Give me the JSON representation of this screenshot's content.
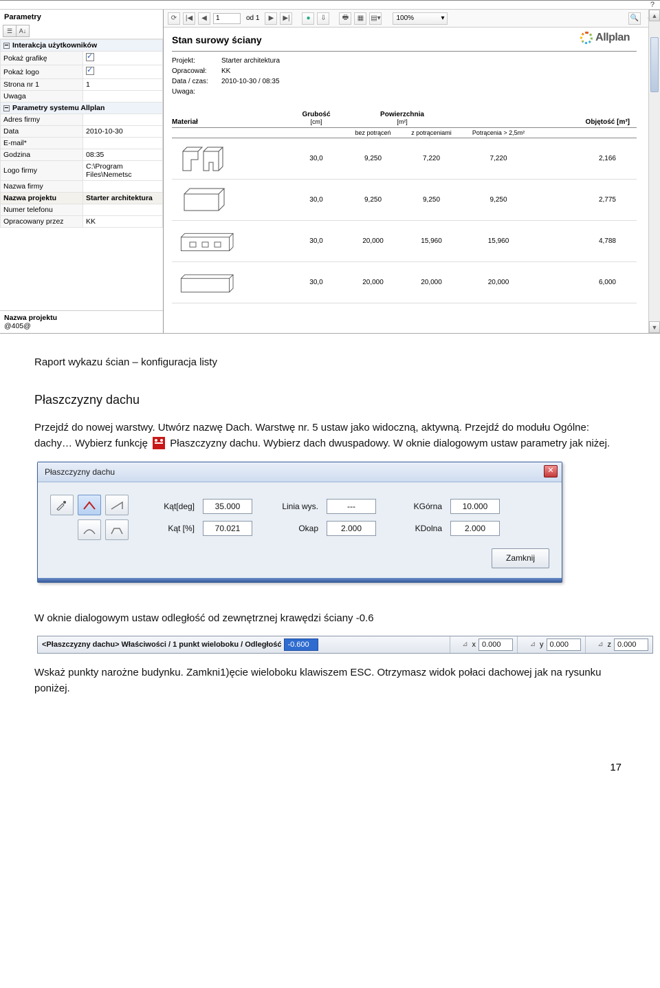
{
  "viewer": {
    "help": "?",
    "prop_title": "Parametry",
    "sections": {
      "s1": "Interakcja użytkowników",
      "s2": "Parametry systemu Allplan"
    },
    "rows": {
      "pokaz_grafike": "Pokaż grafikę",
      "pokaz_logo": "Pokaż logo",
      "strona_nr": "Strona nr 1",
      "strona_nr_val": "1",
      "uwaga": "Uwaga",
      "adres": "Adres firmy",
      "data": "Data",
      "data_val": "2010-10-30",
      "email": "E-mail*",
      "godzina": "Godzina",
      "godzina_val": "08:35",
      "logo_firmy": "Logo firmy",
      "logo_val": "C:\\Program Files\\Nemetsc",
      "nazwa_firmy": "Nazwa firmy",
      "nazwa_proj": "Nazwa projektu",
      "nazwa_proj_val": "Starter architektura",
      "numer_tel": "Numer telefonu",
      "opracowany": "Opracowany przez",
      "opracowany_val": "KK"
    },
    "editor_label": "Nazwa projektu",
    "editor_val": "@405@",
    "toolbar": {
      "page_val": "1",
      "of_label": "od 1",
      "zoom": "100%"
    },
    "logo_text": "Allplan",
    "report_title": "Stan surowy ściany",
    "meta": {
      "projekt_k": "Projekt:",
      "projekt_v": "Starter architektura",
      "opr_k": "Opracował:",
      "opr_v": "KK",
      "dc_k": "Data / czas:",
      "dc_v": "2010-10-30  /  08:35",
      "uw_k": "Uwaga:"
    },
    "thead": {
      "mat": "Materiał",
      "grub": "Grubość",
      "grub_u": "[cm]",
      "pow": "Powierzchnia",
      "pow_u": "[m²]",
      "obj": "Objętość [m³]",
      "s3": "bez potrąceń",
      "s4": "z potrąceniami",
      "s5": "Potrącenia > 2,5m²"
    },
    "rows_data": [
      {
        "g": "30,0",
        "p1": "9,250",
        "p2": "7,220",
        "p3": "7,220",
        "o": "2,166"
      },
      {
        "g": "30,0",
        "p1": "9,250",
        "p2": "9,250",
        "p3": "9,250",
        "o": "2,775"
      },
      {
        "g": "30,0",
        "p1": "20,000",
        "p2": "15,960",
        "p3": "15,960",
        "o": "4,788"
      },
      {
        "g": "30,0",
        "p1": "20,000",
        "p2": "20,000",
        "p3": "20,000",
        "o": "6,000"
      }
    ]
  },
  "doc": {
    "p1": "Raport wykazu ścian – konfiguracja listy",
    "h2": "Płaszczyzny dachu",
    "p2a": "Przejdź do nowej warstwy. Utwórz nazwę Dach. Warstwę nr. 5 ustaw jako widoczną, aktywną. Przejdź do modułu Ogólne:",
    "p2b": "dachy… Wybierz funkcję",
    "p2c": " Płaszczyzny dachu. Wybierz dach dwuspadowy. W oknie dialogowym ustaw parametry jak niżej.",
    "p3": "W oknie dialogowym ustaw odległość od zewnętrznej krawędzi ściany -0.6",
    "p4": "Wskaż punkty narożne budynku. Zamkni1)ęcie wieloboku klawiszem ESC. Otrzymasz widok połaci dachowej jak na rysunku poniżej.",
    "page_no": "17"
  },
  "dlg": {
    "title": "Płaszczyzny dachu",
    "kat_deg_l": "Kąt[deg]",
    "kat_deg_v": "35.000",
    "kat_pct_l": "Kąt [%]",
    "kat_pct_v": "70.021",
    "linia_l": "Linia wys.",
    "linia_v": "---",
    "okap_l": "Okap",
    "okap_v": "2.000",
    "kg_l": "KGórna",
    "kg_v": "10.000",
    "kd_l": "KDolna",
    "kd_v": "2.000",
    "close_btn": "Zamknij"
  },
  "cmd": {
    "prompt": "<Płaszczyzny dachu> Właściwości /   1 punkt wieloboku / Odległość",
    "dist": "-0.600",
    "x_l": "x",
    "x_v": "0.000",
    "y_l": "y",
    "y_v": "0.000",
    "z_l": "z",
    "z_v": "0.000"
  }
}
